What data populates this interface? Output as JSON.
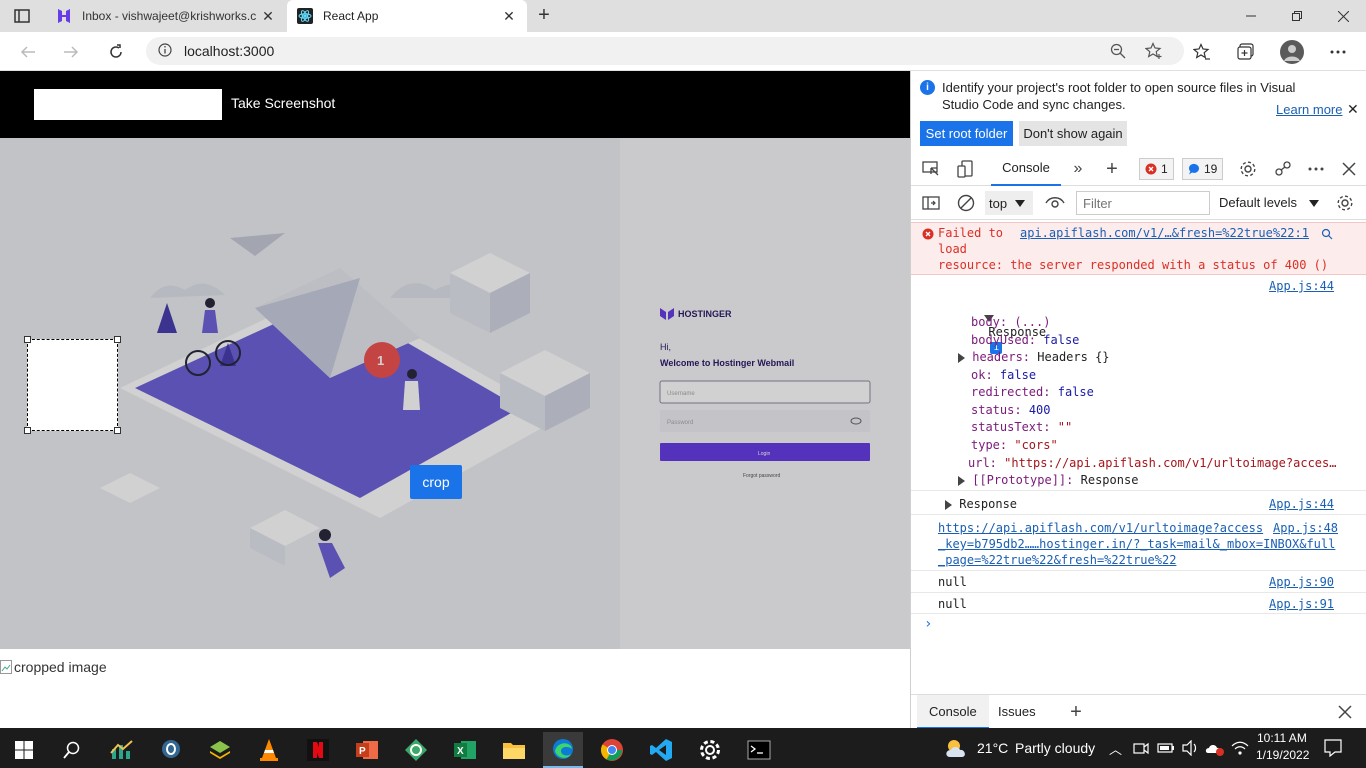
{
  "browser": {
    "tabs": [
      {
        "title": "Inbox - vishwajeet@krishworks.c",
        "active": false,
        "favicon": "hostinger-icon"
      },
      {
        "title": "React App",
        "active": true,
        "favicon": "react-icon"
      }
    ],
    "address": "localhost:3000"
  },
  "page": {
    "take_screenshot_label": "Take Screenshot",
    "crop_label": "crop",
    "cropped_image_alt": "cropped image",
    "screenshot": {
      "brand": "HOSTINGER",
      "greeting": "Hi,",
      "welcome": "Welcome to Hostinger Webmail",
      "username_placeholder": "Username",
      "password_placeholder": "Password",
      "login_label": "Login",
      "forgot_label": "Forgot password",
      "badge_number": "1"
    }
  },
  "devtools": {
    "infobar": {
      "message": "Identify your project's root folder to open source files in Visual Studio Code and sync changes.",
      "learn_more": "Learn more",
      "set_root": "Set root folder",
      "dont_show": "Don't show again"
    },
    "tab_console": "Console",
    "error_count": "1",
    "message_count": "19",
    "context": "top",
    "filter_placeholder": "Filter",
    "levels": "Default levels",
    "console": {
      "error": {
        "prefix": "Failed to",
        "link": "api.apiflash.com/v1/…&fresh=%22true%22:1",
        "line2": "load",
        "line3": "resource: the server responded with a status of 400 ()"
      },
      "response_src": "App.js:44",
      "response_label": "Response",
      "fields": {
        "body": "body: (...)",
        "bodyUsed_k": "bodyUsed:",
        "bodyUsed_v": "false",
        "headers_k": "headers:",
        "headers_v": "Headers {}",
        "ok_k": "ok:",
        "ok_v": "false",
        "redirected_k": "redirected:",
        "redirected_v": "false",
        "status_k": "status:",
        "status_v": "400",
        "statusText_k": "statusText:",
        "statusText_v": "\"\"",
        "type_k": "type:",
        "type_v": "\"cors\"",
        "url_k": "url:",
        "url_v": "\"https://api.apiflash.com/v1/urltoimage?acces…",
        "proto_k": "[[Prototype]]:",
        "proto_v": "Response"
      },
      "response2_label": "Response",
      "response2_src": "App.js:44",
      "url_line1": "https://api.apiflash.com/v1/urltoimage?access",
      "url_line2": "_key=b795db2……hostinger.in/?_task=mail&_mbox=INBOX&full",
      "url_line3": "_page=%22true%22&fresh=%22true%22",
      "url_src": "App.js:48",
      "null1": "null",
      "null1_src": "App.js:90",
      "null2": "null",
      "null2_src": "App.js:91",
      "prompt": "›"
    },
    "drawer": {
      "console": "Console",
      "issues": "Issues"
    }
  },
  "taskbar": {
    "weather_temp": "21°C",
    "weather_text": "Partly cloudy",
    "time": "10:11 AM",
    "date": "1/19/2022"
  }
}
